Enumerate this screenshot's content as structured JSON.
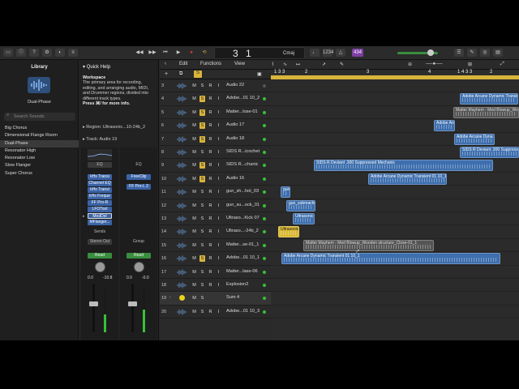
{
  "topbar": {
    "lcd_bar": "3",
    "lcd_beat": "1",
    "key": "Cmaj",
    "badge": "434"
  },
  "library": {
    "title": "Library",
    "patch": "Dual-Phase",
    "search_placeholder": "Search Sounds",
    "items": [
      "Big Chorus",
      "Dimensional Flange Room",
      "Dual-Phase",
      "Resonator High",
      "Resonator Low",
      "Slow Flanger",
      "Super Chorus"
    ],
    "selected": 2
  },
  "inspector": {
    "quick_help": "Quick Help",
    "qh_title": "Workspace",
    "qh_text": "The primary area for recording, editing, and arranging audio, MIDI, and Drummer regions, divided into different track types.",
    "qh_more": "Press ⌘/ for more info.",
    "region_label": "Region:",
    "region_name": "Ultrasonic...10-24b_2",
    "track_label": "Track:",
    "track_name": "Audio 19",
    "strip1": {
      "eq": "EQ",
      "plugins": [
        "kHs Transi",
        "Channel EQ",
        "kHs Transi",
        "kHs Freque",
        "FF Pro-R",
        "LFOTool",
        "ModDel",
        "MFlanger..."
      ],
      "sends": "Sends",
      "output": "Stereo Out",
      "mode": "Read",
      "vol": "0.0",
      "peak": "-10.8"
    },
    "strip2": {
      "eq": "EQ",
      "plugins": [
        "FreeClip",
        "FF Pro-L 2"
      ],
      "group": "Group",
      "mode": "Read",
      "vol": "0.0",
      "peak": "-0.0"
    }
  },
  "tracks_toolbar": {
    "edit": "Edit",
    "functions": "Functions",
    "view": "View"
  },
  "ruler": {
    "bars": [
      "1 3 3",
      "2",
      "3",
      "4",
      "1 4 3 3",
      "2"
    ]
  },
  "tracks": [
    {
      "num": "3",
      "name": "Audio 22",
      "solo": false,
      "dot": "gray"
    },
    {
      "num": "4",
      "name": "Adobe...01 10_2",
      "solo": true,
      "dot": "green"
    },
    {
      "num": "5",
      "name": "Matter...lose-01",
      "solo": true,
      "dot": "green"
    },
    {
      "num": "6",
      "name": "Audio 17",
      "solo": true,
      "dot": "green"
    },
    {
      "num": "7",
      "name": "Audio 18",
      "solo": true,
      "dot": "green"
    },
    {
      "num": "8",
      "name": "SIDS R...icochet",
      "solo": false,
      "dot": "green"
    },
    {
      "num": "9",
      "name": "SIDS R...chanic",
      "solo": true,
      "dot": "green"
    },
    {
      "num": "10",
      "name": "Audio 16",
      "solo": true,
      "dot": "green"
    },
    {
      "num": "11",
      "name": "gun_sh...hot_03",
      "solo": false,
      "dot": "green"
    },
    {
      "num": "12",
      "name": "gun_su...ock_01",
      "solo": false,
      "dot": "green"
    },
    {
      "num": "13",
      "name": "Ultraso...Kick 07",
      "solo": false,
      "dot": "green"
    },
    {
      "num": "14",
      "name": "Ultraso...-24b_2",
      "solo": false,
      "dot": "green"
    },
    {
      "num": "15",
      "name": "Matter...se-01_1",
      "solo": false,
      "dot": "green"
    },
    {
      "num": "16",
      "name": "Adobe...01 10_1",
      "solo": true,
      "dot": "green"
    },
    {
      "num": "17",
      "name": "Matter...lase-06",
      "solo": false,
      "dot": "green"
    },
    {
      "num": "18",
      "name": "Explosion2",
      "solo": false,
      "dot": "green"
    },
    {
      "num": "19",
      "name": "Sum 4",
      "solo": false,
      "dot": "green"
    },
    {
      "num": "20",
      "name": "Adobe...01 10_3",
      "solo": false,
      "dot": "green"
    }
  ],
  "regions": [
    {
      "lane": 1,
      "label": "Adobe Arcane Dynamic Transie",
      "color": "blue"
    },
    {
      "lane": 2,
      "label": "Matter Mayhem - Med Blowup_Woo",
      "color": "gray"
    },
    {
      "lane": 3,
      "label": "Adobe Arc",
      "color": "blue"
    },
    {
      "lane": 4,
      "label": "Adobe Arcane Dyna",
      "color": "blue"
    },
    {
      "lane": 5,
      "label": "SIDS R Deviant .300 Suppresse",
      "color": "blue"
    },
    {
      "lane": 6,
      "label": "SIDS R Deviant .300 Suppressed Mechanic",
      "color": "blue"
    },
    {
      "lane": 7,
      "label": "Adobe Arcane Dynamic Transient 01 10_1",
      "color": "blue"
    },
    {
      "lane": 8,
      "label": "gun",
      "color": "blue"
    },
    {
      "lane": 9,
      "label": "gun_submachi",
      "color": "blue"
    },
    {
      "lane": 10,
      "label": "Ultrasonic",
      "color": "blue"
    },
    {
      "lane": 11,
      "label": "Ultrasonic",
      "color": "yellow"
    },
    {
      "lane": 12,
      "label": "Matter Mayhem - Med Blowup_Wooden structure_Close-01_1",
      "color": "gray"
    },
    {
      "lane": 13,
      "label": "Adobe Arcane Dynamic Transient 01 10_1",
      "color": "blue"
    }
  ]
}
